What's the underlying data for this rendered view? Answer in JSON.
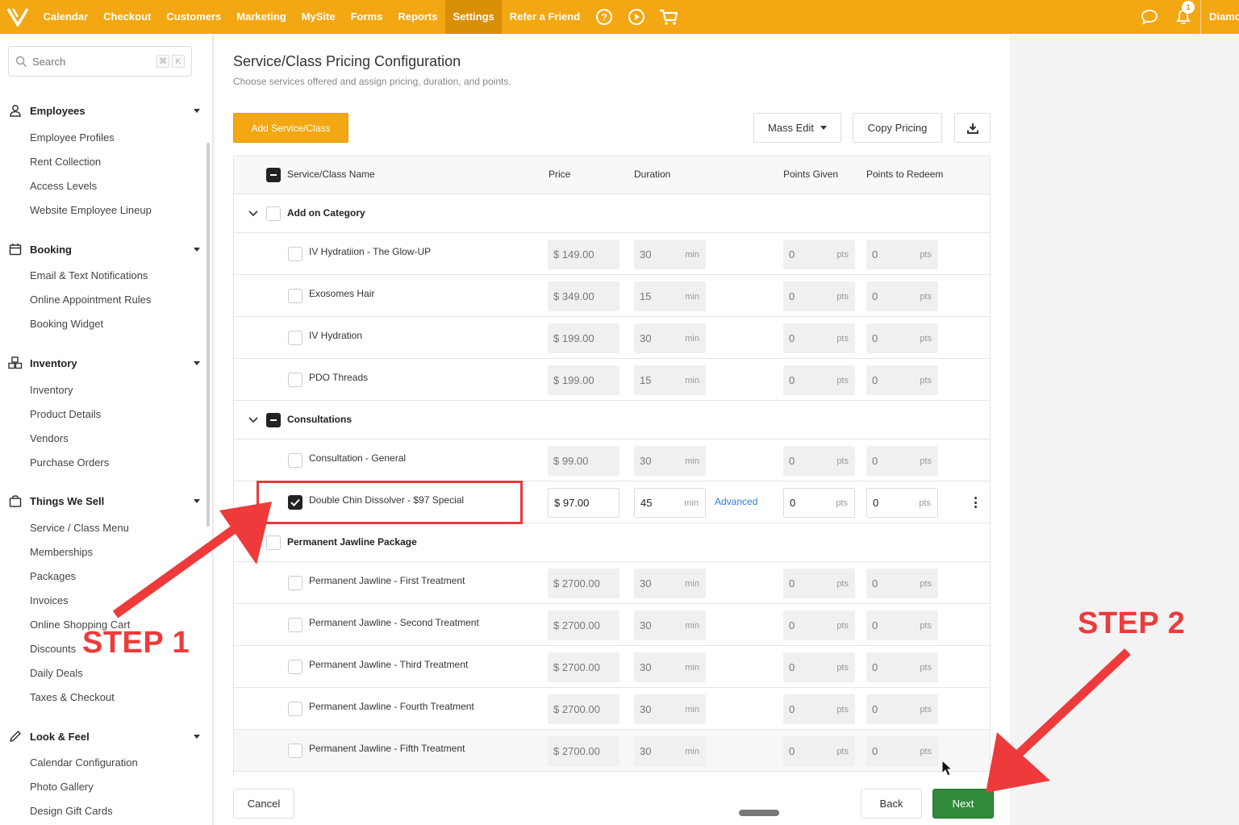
{
  "topbar": {
    "nav": [
      "Calendar",
      "Checkout",
      "Customers",
      "Marketing",
      "MySite",
      "Forms",
      "Reports",
      "Settings",
      "Refer a Friend"
    ],
    "active": "Settings",
    "notification_count": "1",
    "user_name": "Diamo"
  },
  "sidebar": {
    "search_placeholder": "Search",
    "shortcut": [
      "⌘",
      "K"
    ],
    "sections": [
      {
        "label": "Employees",
        "icon": "person-icon",
        "items": [
          "Employee Profiles",
          "Rent Collection",
          "Access Levels",
          "Website Employee Lineup"
        ]
      },
      {
        "label": "Booking",
        "icon": "calendar-icon",
        "items": [
          "Email & Text Notifications",
          "Online Appointment Rules",
          "Booking Widget"
        ]
      },
      {
        "label": "Inventory",
        "icon": "boxes-icon",
        "items": [
          "Inventory",
          "Product Details",
          "Vendors",
          "Purchase Orders"
        ]
      },
      {
        "label": "Things We Sell",
        "icon": "shopping-bag-icon",
        "items": [
          "Service / Class Menu",
          "Memberships",
          "Packages",
          "Invoices",
          "Online Shopping Cart",
          "Discounts",
          "Daily Deals",
          "Taxes & Checkout"
        ]
      },
      {
        "label": "Look & Feel",
        "icon": "pencil-icon",
        "items": [
          "Calendar Configuration",
          "Photo Gallery",
          "Design Gift Cards"
        ]
      }
    ]
  },
  "main": {
    "title": "Service/Class Pricing Configuration",
    "subtitle": "Choose services offered and assign pricing, duration, and points.",
    "add_button": "Add Service/Class",
    "mass_edit": "Mass Edit",
    "copy_pricing": "Copy Pricing",
    "columns": {
      "name": "Service/Class Name",
      "price": "Price",
      "duration": "Duration",
      "points_given": "Points Given",
      "points_redeem": "Points to Redeem"
    },
    "units": {
      "currency": "$",
      "duration": "min",
      "points": "pts"
    },
    "advanced_label": "Advanced",
    "rows": [
      {
        "type": "category",
        "name": "Add on Category"
      },
      {
        "type": "service",
        "name": "IV Hydratiion - The Glow-UP",
        "price": "149.00",
        "duration": "30",
        "given": "0",
        "redeem": "0"
      },
      {
        "type": "service",
        "name": "Exosomes Hair",
        "price": "349.00",
        "duration": "15",
        "given": "0",
        "redeem": "0"
      },
      {
        "type": "service",
        "name": "IV Hydration",
        "price": "199.00",
        "duration": "30",
        "given": "0",
        "redeem": "0"
      },
      {
        "type": "service",
        "name": "PDO Threads",
        "price": "199.00",
        "duration": "15",
        "given": "0",
        "redeem": "0"
      },
      {
        "type": "category",
        "name": "Consultations"
      },
      {
        "type": "service",
        "name": "Consultation - General",
        "price": "99.00",
        "duration": "30",
        "given": "0",
        "redeem": "0"
      },
      {
        "type": "service",
        "name": "Double Chin Dissolver - $97 Special",
        "price": "97.00",
        "duration": "45",
        "given": "0",
        "redeem": "0",
        "checked": true
      },
      {
        "type": "category",
        "name": "Permanent Jawline Package"
      },
      {
        "type": "service",
        "name": "Permanent Jawline - First Treatment",
        "price": "2700.00",
        "duration": "30",
        "given": "0",
        "redeem": "0"
      },
      {
        "type": "service",
        "name": "Permanent Jawline - Second Treatment",
        "price": "2700.00",
        "duration": "30",
        "given": "0",
        "redeem": "0"
      },
      {
        "type": "service",
        "name": "Permanent Jawline - Third Treatment",
        "price": "2700.00",
        "duration": "30",
        "given": "0",
        "redeem": "0"
      },
      {
        "type": "service",
        "name": "Permanent Jawline - Fourth Treatment",
        "price": "2700.00",
        "duration": "30",
        "given": "0",
        "redeem": "0"
      },
      {
        "type": "service",
        "name": "Permanent Jawline - Fifth Treatment",
        "price": "2700.00",
        "duration": "30",
        "given": "0",
        "redeem": "0"
      }
    ],
    "cancel": "Cancel",
    "back": "Back",
    "next": "Next"
  },
  "annotations": {
    "step1": "STEP 1",
    "step2": "STEP 2"
  },
  "colors": {
    "brand": "#f3a712",
    "next": "#2f8a3a",
    "annotation": "#ee3a3a",
    "link": "#2b7bd6"
  }
}
